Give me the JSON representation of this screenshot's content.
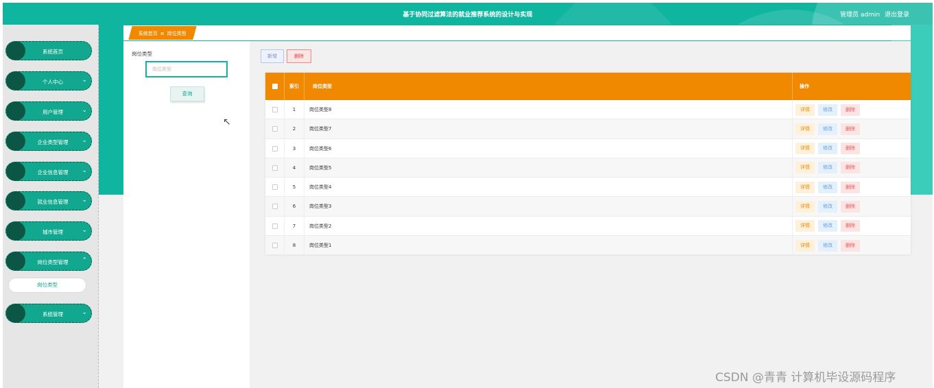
{
  "header": {
    "title": "基于协同过滤算法的就业推荐系统的设计与实现",
    "user_role": "管理员 admin",
    "logout": "退出登录"
  },
  "sidebar": {
    "items": [
      {
        "label": "系统首页",
        "chevron": ""
      },
      {
        "label": "个人中心",
        "chevron": "⌄"
      },
      {
        "label": "用户管理",
        "chevron": "⌄"
      },
      {
        "label": "企业类型管理",
        "chevron": "⌄"
      },
      {
        "label": "企业信息管理",
        "chevron": "⌄"
      },
      {
        "label": "就业信息管理",
        "chevron": "⌄"
      },
      {
        "label": "城市管理",
        "chevron": "⌄"
      },
      {
        "label": "岗位类型管理",
        "chevron": "⌃"
      },
      {
        "label": "系统管理",
        "chevron": "⌄"
      }
    ],
    "submenu": {
      "label": "岗位类型"
    }
  },
  "breadcrumb": {
    "home": "系统首页",
    "separator": "≡",
    "current": "岗位类型"
  },
  "search": {
    "label": "岗位类型",
    "placeholder": "岗位类型",
    "button": "查询"
  },
  "toolbar": {
    "add": "新增",
    "delete": "删除"
  },
  "table": {
    "headers": {
      "index": "索引",
      "type": "岗位类型",
      "ops": "操作"
    },
    "ops": {
      "detail": "详情",
      "edit": "修改",
      "delete": "删除"
    },
    "rows": [
      {
        "index": "1",
        "type": "岗位类型8"
      },
      {
        "index": "2",
        "type": "岗位类型7"
      },
      {
        "index": "3",
        "type": "岗位类型6"
      },
      {
        "index": "4",
        "type": "岗位类型5"
      },
      {
        "index": "5",
        "type": "岗位类型4"
      },
      {
        "index": "6",
        "type": "岗位类型3"
      },
      {
        "index": "7",
        "type": "岗位类型2"
      },
      {
        "index": "8",
        "type": "岗位类型1"
      }
    ]
  },
  "watermark": "CSDN @青青  计算机毕设源码程序",
  "colors": {
    "primary": "#10b5a0",
    "accent": "#f08800",
    "menu_dot": "#0c5646"
  }
}
